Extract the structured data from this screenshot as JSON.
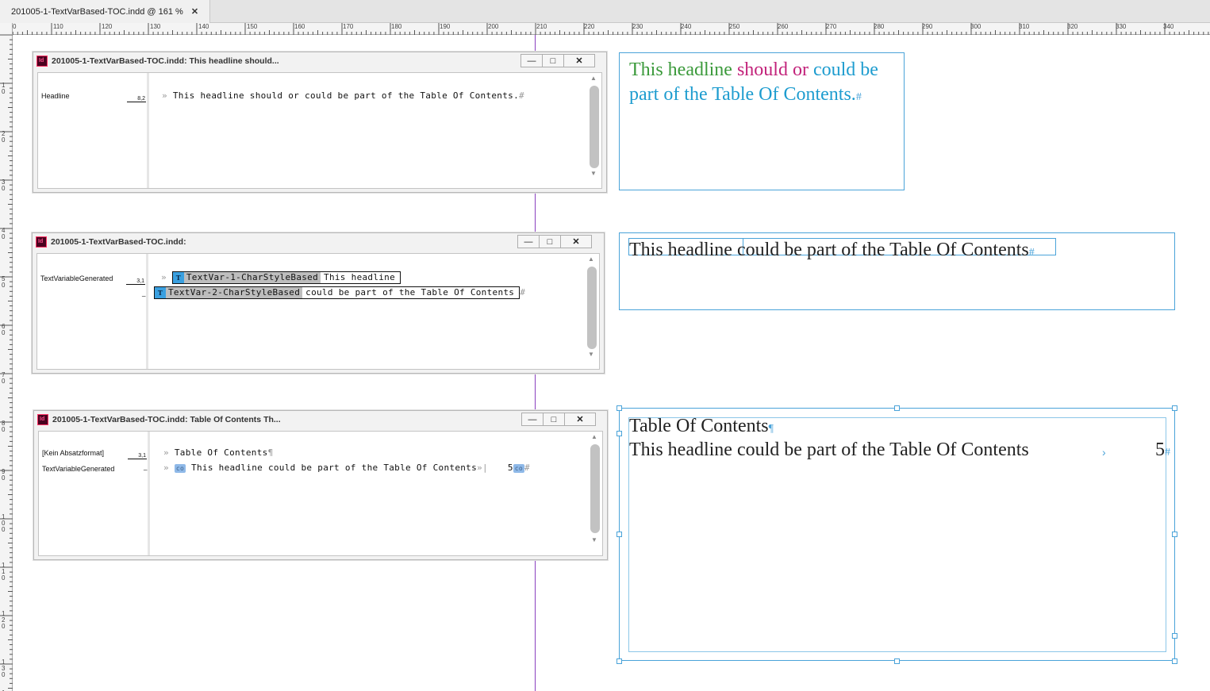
{
  "tab": {
    "title": "201005-1-TextVarBased-TOC.indd @ 161 %",
    "close": "✕"
  },
  "ruler": {
    "h_labels": [
      "0",
      "110",
      "120",
      "130",
      "140",
      "150",
      "160",
      "170",
      "180",
      "190",
      "200",
      "210",
      "220",
      "230",
      "240",
      "250",
      "260",
      "270",
      "280",
      "290",
      "300",
      "310",
      "320",
      "330",
      "340"
    ],
    "v_labels": [
      "10",
      "20",
      "30",
      "40",
      "50",
      "60",
      "70",
      "80",
      "90",
      "100",
      "110",
      "120",
      "130",
      "140"
    ]
  },
  "windows": [
    {
      "title": "201005-1-TextVarBased-TOC.indd: This headline should...",
      "styles": [
        {
          "name": "Headline",
          "depth": "8,2"
        }
      ],
      "line1": "This headline should or could be part of the Table Of Contents.",
      "end": "#"
    },
    {
      "title": "201005-1-TextVarBased-TOC.indd:",
      "styles": [
        {
          "name": "TextVariableGenerated",
          "depth": "3,1"
        }
      ],
      "var1": {
        "name": "TextVar-1-CharStyleBased",
        "value": "This headline"
      },
      "var2": {
        "name": "TextVar-2-CharStyleBased",
        "value": "could be part of the Table Of Contents"
      },
      "end": "#"
    },
    {
      "title": "201005-1-TextVarBased-TOC.indd: Table Of Contents Th...",
      "styles": [
        {
          "name": "[Kein Absatzformat]",
          "depth": "3,1"
        },
        {
          "name": "TextVariableGenerated",
          "depth": ""
        }
      ],
      "line1": "Table Of Contents",
      "pilcrow": "¶",
      "line2": "This headline could be part of the Table Of Contents",
      "page": "5",
      "end": "#"
    }
  ],
  "frames": {
    "frame1": {
      "line1_a": "This headline ",
      "line1_b": "should or ",
      "line1_c": "could be",
      "line2": "part of the Table Of Contents.",
      "end": "#",
      "colors": {
        "green": "#3b9a3b",
        "magenta": "#c2227a",
        "cyan": "#1d9ccf"
      }
    },
    "frame2": {
      "text": "This headline could be part of the Table Of Contents",
      "end": "#"
    },
    "frame3": {
      "line1": "Table Of Contents",
      "pilcrow": "¶",
      "line2": "This headline could be part of the Table Of Contents",
      "page": "5",
      "end": "#"
    }
  },
  "icons": {
    "minimize": "—",
    "maximize": "□",
    "close": "✕",
    "up": "▲",
    "down": "▼",
    "xref": "co"
  }
}
